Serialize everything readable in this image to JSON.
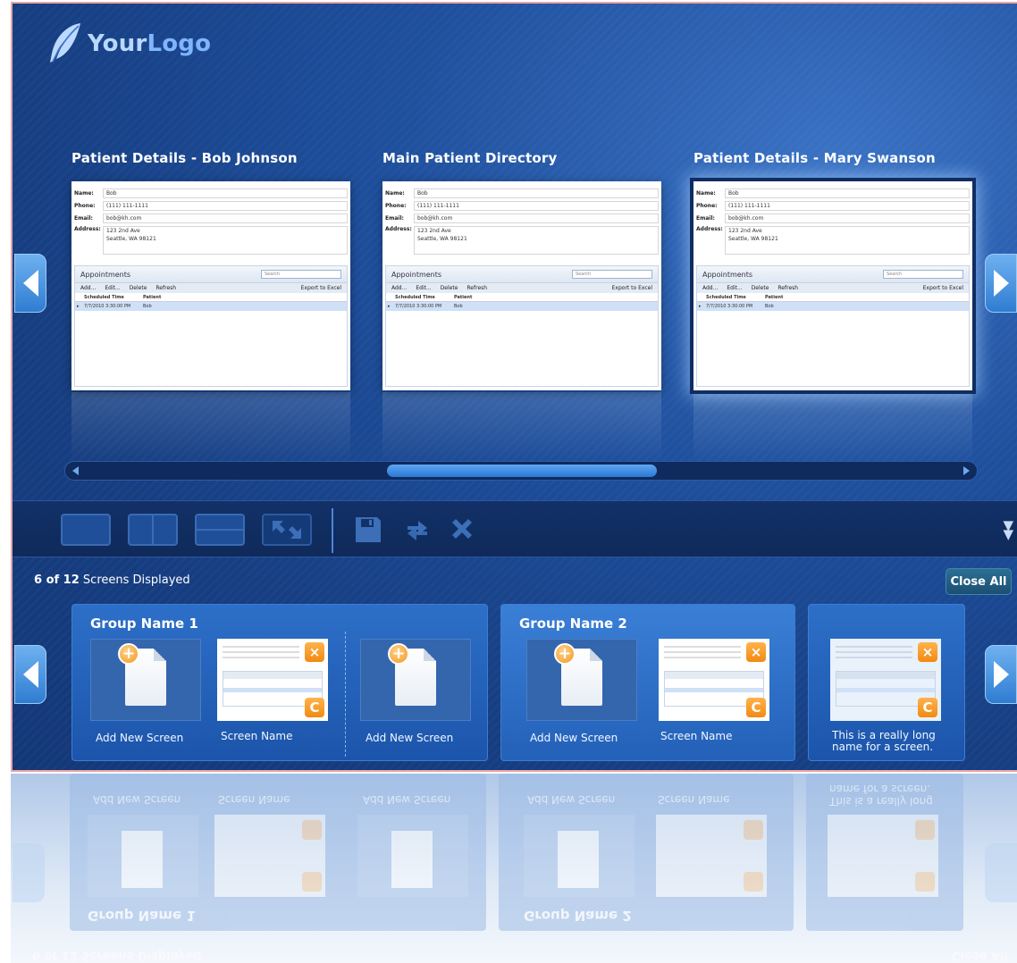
{
  "logo": {
    "text_prefix": "Your",
    "text_suffix": "Logo"
  },
  "previews": [
    {
      "title": "Patient Details - Bob Johnson",
      "active": false
    },
    {
      "title": "Main Patient Directory",
      "active": false
    },
    {
      "title": "Patient Details - Mary Swanson",
      "active": true
    }
  ],
  "form": {
    "name_label": "Name:",
    "name_value": "Bob",
    "phone_label": "Phone:",
    "phone_value": "(111) 111-1111",
    "email_label": "Email:",
    "email_value": "bob@kh.com",
    "address_label": "Address:",
    "address_line1": "123 2nd Ave",
    "address_line2": "Seattle, WA 98121",
    "appointments_title": "Appointments",
    "search_placeholder": "Search",
    "toolbar": [
      "Add...",
      "Edit...",
      "Delete",
      "Refresh"
    ],
    "export_label": "Export to Excel",
    "columns": [
      "Scheduled Time",
      "Patient"
    ],
    "row": [
      "7/7/2010 3:30:00 PM",
      "Bob"
    ]
  },
  "status": {
    "count": "6 of 12",
    "suffix": " Screens Displayed"
  },
  "close_all_label": "Close All",
  "groups": [
    {
      "title": "Group Name 1"
    },
    {
      "title": "Group Name 2"
    }
  ],
  "tiles": {
    "add_new_label": "Add New Screen",
    "screen_name_label": "Screen Name",
    "long_name_label_line1": "This is a really long",
    "long_name_label_line2": "name for a screen."
  },
  "icons": {
    "x_badge": "×",
    "c_badge": "C",
    "plus_badge": "+",
    "collapse": "▼▼"
  },
  "colors": {
    "background": "#1e4f9d",
    "accent": "#2f7dd2",
    "badge": "#f28a12"
  }
}
